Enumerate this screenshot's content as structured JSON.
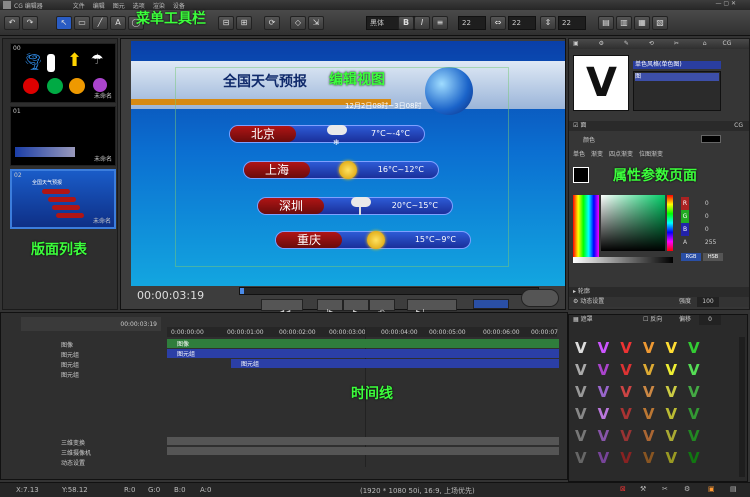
{
  "window": {
    "title": "CG 编辑器"
  },
  "menu": {
    "items": [
      "文件",
      "编辑",
      "图元",
      "选项",
      "渲染",
      "设备"
    ]
  },
  "annotations": {
    "menu_toolbar": "菜单工具栏",
    "edit_view": "编辑视图",
    "page_list": "版面列表",
    "props_page": "属性参数页面",
    "timeline": "时间线"
  },
  "toolbar": {
    "font": "黑体",
    "size1": "22",
    "size2": "22",
    "size3": "22"
  },
  "pages": [
    {
      "num": "00",
      "name": "未命名"
    },
    {
      "num": "01",
      "name": "未命名"
    },
    {
      "num": "02",
      "name": "未命名"
    }
  ],
  "canvas": {
    "title": "全国天气预报",
    "date": "12月2日08时~3日08时",
    "cities": [
      {
        "name": "北京",
        "temp": "7°C~-4°C",
        "icon": "snow-cloud-icon"
      },
      {
        "name": "上海",
        "temp": "16°C~12°C",
        "icon": "sun-icon"
      },
      {
        "name": "深圳",
        "temp": "20°C~15°C",
        "icon": "cloud-icon"
      },
      {
        "name": "重庆",
        "temp": "15°C~9°C",
        "icon": "sun-icon"
      }
    ]
  },
  "playback": {
    "timecode": "00:00:03:19"
  },
  "timeline": {
    "timecode": "00:00:03:19",
    "ruler": [
      "0:00:00:00",
      "00:00:01:00",
      "00:00:02:00",
      "00:00:03:00",
      "00:00:04:00",
      "00:00:05:00",
      "00:00:06:00",
      "00:00:07"
    ],
    "tracks": [
      {
        "label": "图像",
        "clip": "图像"
      },
      {
        "label": "图元组",
        "clip": "图元组"
      },
      {
        "label": "图元组",
        "clip": "图元组"
      },
      {
        "label": "图元组",
        "clip": ""
      }
    ],
    "bottom_tracks": [
      "三维变换",
      "三维摄像机",
      "动态设置"
    ]
  },
  "props": {
    "style_label": "单色风格(单色图)",
    "style_item": "图",
    "section": "面",
    "color_label": "颜色",
    "tabs": [
      "单色",
      "渐变",
      "四点渐变",
      "位图渐变"
    ],
    "rgb": {
      "R": "0",
      "G": "0",
      "B": "0",
      "A": "255"
    },
    "rgb_btn": "RGB",
    "hsb_btn": "HSB",
    "outline": "轮廓",
    "dynamic": "动态设置",
    "mask": "遮罩",
    "strength_label": "强度",
    "strength": "100",
    "offset_label": "偏移",
    "offset": "0",
    "reverse": "反向"
  },
  "colors": {
    "accent": "#3cff3c",
    "track_green": "#2f7d3c",
    "track_blue": "#2b3fa6",
    "city_red": "#b01515"
  },
  "status": {
    "x": "X:7.13",
    "y": "Y:58.12",
    "r": "R:0",
    "g": "G:0",
    "b": "B:0",
    "a": "A:0",
    "res": "(1920 * 1080 50i, 16:9, 上场优先)"
  }
}
